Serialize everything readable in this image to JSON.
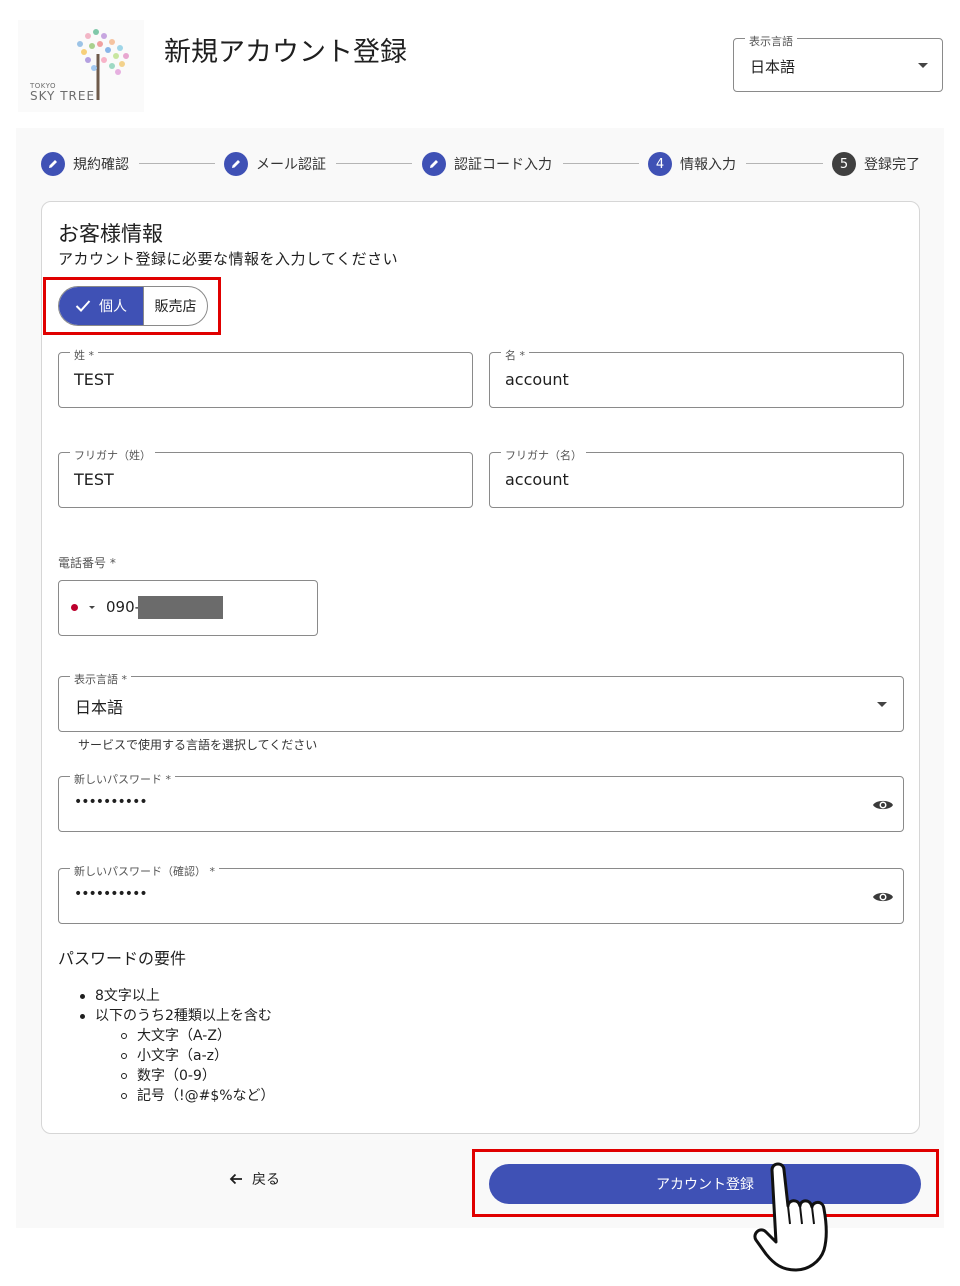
{
  "header": {
    "logo_small": "TOKYO",
    "logo_text": "SKY TREE",
    "title": "新規アカウント登録",
    "language_label": "表示言語",
    "language_value": "日本語"
  },
  "steps": [
    {
      "number": "",
      "label": "規約確認",
      "state": "done"
    },
    {
      "number": "",
      "label": "メール認証",
      "state": "done"
    },
    {
      "number": "",
      "label": "認証コード入力",
      "state": "done"
    },
    {
      "number": "4",
      "label": "情報入力",
      "state": "active"
    },
    {
      "number": "5",
      "label": "登録完了",
      "state": "todo"
    }
  ],
  "card": {
    "title": "お客様情報",
    "subtitle": "アカウント登録に必要な情報を入力してください"
  },
  "customer_type": {
    "options": [
      "個人",
      "販売店"
    ],
    "selected": "個人"
  },
  "fields": {
    "last_name": {
      "label": "姓 *",
      "value": "TEST"
    },
    "first_name": {
      "label": "名 *",
      "value": "account"
    },
    "last_name_kana": {
      "label": "フリガナ（姓）",
      "value": "TEST"
    },
    "first_name_kana": {
      "label": "フリガナ（名）",
      "value": "account"
    },
    "phone": {
      "label": "電話番号 *",
      "value": "090-"
    },
    "display_language": {
      "label": "表示言語 *",
      "value": "日本語",
      "helper": "サービスで使用する言語を選択してください"
    },
    "new_password": {
      "label": "新しいパスワード *",
      "value": "••••••••••"
    },
    "confirm_password": {
      "label": "新しいパスワード（確認） *",
      "value": "••••••••••"
    }
  },
  "password_requirements": {
    "title": "パスワードの要件",
    "items": [
      "8文字以上",
      "以下のうち2種類以上を含む"
    ],
    "sub_items": [
      "大文字（A-Z）",
      "小文字（a-z）",
      "数字（0-9）",
      "記号（!@#$%など）"
    ]
  },
  "actions": {
    "back_label": "戻る",
    "submit_label": "アカウント登録"
  },
  "colors": {
    "primary": "#3f51b5",
    "highlight": "#e00000",
    "flag_red": "#bc002d"
  }
}
